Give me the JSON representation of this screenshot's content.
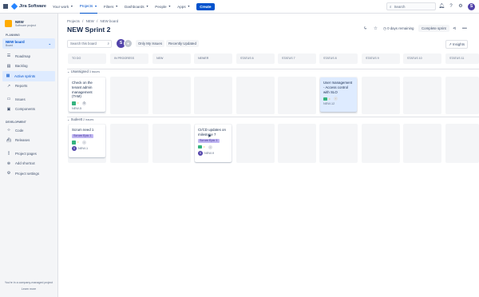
{
  "app": {
    "name": "Jira Software"
  },
  "topnav": {
    "items": [
      "Your work",
      "Projects",
      "Filters",
      "Dashboards",
      "People",
      "Apps"
    ],
    "create": "Create",
    "search_placeholder": "Search"
  },
  "sidebar": {
    "project_name": "NEW",
    "project_type": "Software project",
    "planning_label": "PLANNING",
    "board_name": "NEW board",
    "board_sub": "Board",
    "planning_items": [
      "Roadmap",
      "Backlog",
      "Active sprints",
      "Reports"
    ],
    "mid_items": [
      "Issues",
      "Components"
    ],
    "dev_label": "DEVELOPMENT",
    "dev_items": [
      "Code",
      "Releases"
    ],
    "extra_items": [
      "Project pages",
      "Add shortcut",
      "Project settings"
    ],
    "footer_line": "You're in a company-managed project",
    "footer_link": "Learn more"
  },
  "breadcrumb": [
    "Projects",
    "/",
    "NEW",
    "/",
    "NEW board"
  ],
  "page_title": "NEW Sprint 2",
  "header": {
    "days_remaining": "0 days remaining",
    "complete_sprint": "Complete sprint"
  },
  "toolbar": {
    "search_placeholder": "Search this board",
    "avatar_initial": "S",
    "only_my_issues": "Only My Issues",
    "recently_updated": "Recently Updated",
    "insights": "Insights"
  },
  "columns": [
    "TO DO",
    "IN PROGRESS",
    "NEW",
    "NEWER",
    "STATUS 6",
    "STATUS 7",
    "STATUS 8",
    "STATUS 9",
    "STATUS 10",
    "STATUS 11"
  ],
  "swimlanes": [
    {
      "title": "Unassigned",
      "count": "3 issues",
      "cards": [
        {
          "col": 0,
          "summary": "Check on the tenant admin management (TAM)",
          "key": "NEW-5",
          "estimate": "0",
          "epic": ""
        },
        {
          "col": 6,
          "summary": "User management - Access control with SLO",
          "key": "NEW-12",
          "estimate": "-",
          "epic": ""
        }
      ]
    },
    {
      "title": "Sudeett",
      "count": "2 issues",
      "cards": [
        {
          "col": 0,
          "summary": "Scrum need 1",
          "key": "NEW-1",
          "estimate": "-",
          "epic": "Scrum Epic 1"
        },
        {
          "col": 3,
          "summary": "CI/CD updates on milestone 7",
          "key": "NEW-9",
          "estimate": "-",
          "epic": "Scrum Epic 1"
        }
      ]
    }
  ],
  "colors": {
    "accent": "#0052cc",
    "selected_card": "#deebff",
    "epic": "#c0b6f2"
  }
}
